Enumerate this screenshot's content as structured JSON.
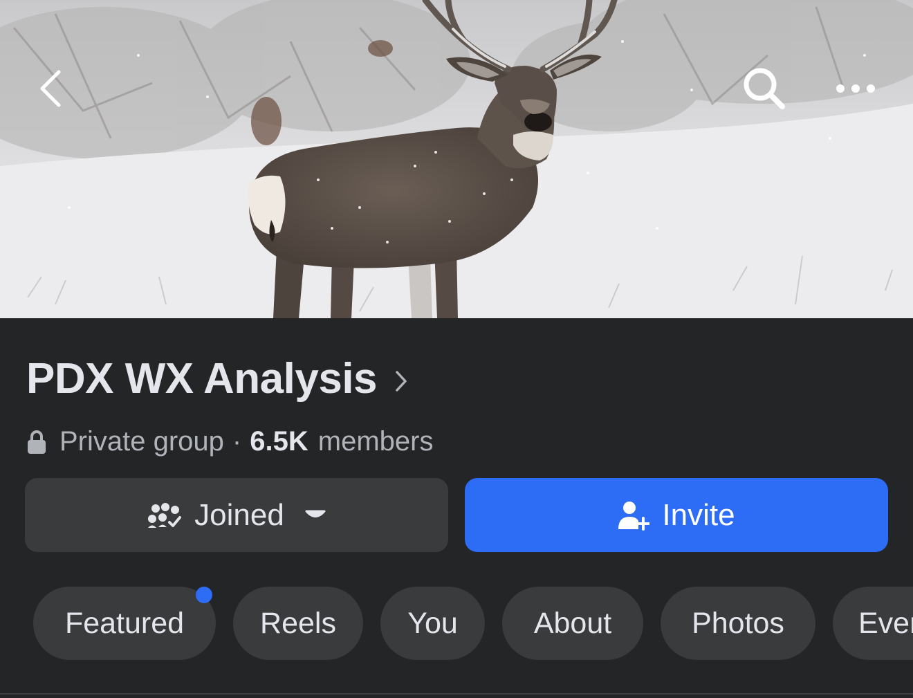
{
  "cover": {
    "alt": "Mule deer buck standing in falling snow"
  },
  "nav": {
    "back_icon": "chevron-left-icon",
    "search_icon": "search-icon",
    "more_icon": "more-horizontal-icon"
  },
  "group": {
    "name": "PDX WX Analysis",
    "privacy": "Private group",
    "separator": "·",
    "member_count": "6.5K",
    "member_label": "members"
  },
  "actions": {
    "joined_label": "Joined",
    "invite_label": "Invite"
  },
  "tabs": [
    {
      "label": "Featured",
      "has_badge": true
    },
    {
      "label": "Reels"
    },
    {
      "label": "You"
    },
    {
      "label": "About"
    },
    {
      "label": "Photos"
    },
    {
      "label": "Events"
    }
  ],
  "colors": {
    "background": "#242526",
    "surface": "#3a3b3c",
    "accent": "#2d6cf5",
    "text_primary": "#e4e6eb",
    "text_secondary": "#b0b3b8"
  }
}
